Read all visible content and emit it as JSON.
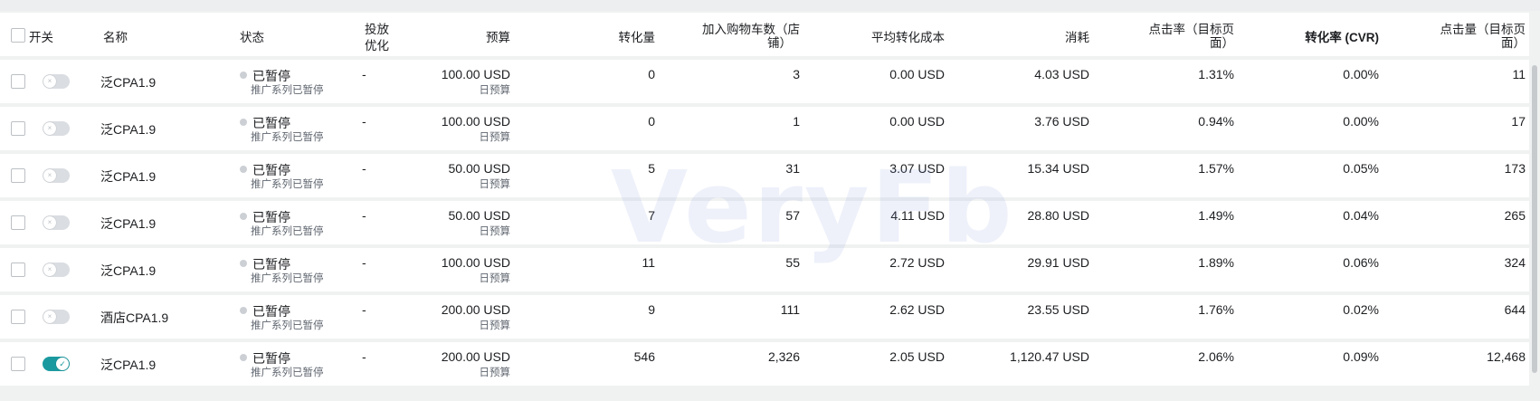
{
  "header": {
    "switch": "开关",
    "name": "名称",
    "status": "状态",
    "delivery_line1": "投放",
    "delivery_line2": "优化",
    "budget": "预算",
    "conversions": "转化量",
    "add_to_cart_line1": "加入购物车数（店",
    "add_to_cart_line2": "铺）",
    "avg_cost": "平均转化成本",
    "spend": "消耗",
    "ctr_line1": "点击率（目标页",
    "ctr_line2": "面）",
    "cvr": "转化率 (CVR)",
    "clicks_line1": "点击量（目标页",
    "clicks_line2": "面）"
  },
  "rows": [
    {
      "on": false,
      "name": "泛CPA1.9",
      "status": "已暂停",
      "status_sub": "推广系列已暂停",
      "delivery": "-",
      "budget": "100.00 USD",
      "budget_sub": "日预算",
      "conversions": "0",
      "add_to_cart": "3",
      "avg_cost": "0.00 USD",
      "spend": "4.03 USD",
      "ctr": "1.31%",
      "cvr": "0.00%",
      "clicks": "11"
    },
    {
      "on": false,
      "name": "泛CPA1.9",
      "status": "已暂停",
      "status_sub": "推广系列已暂停",
      "delivery": "-",
      "budget": "100.00 USD",
      "budget_sub": "日预算",
      "conversions": "0",
      "add_to_cart": "1",
      "avg_cost": "0.00 USD",
      "spend": "3.76 USD",
      "ctr": "0.94%",
      "cvr": "0.00%",
      "clicks": "17"
    },
    {
      "on": false,
      "name": "泛CPA1.9",
      "status": "已暂停",
      "status_sub": "推广系列已暂停",
      "delivery": "-",
      "budget": "50.00 USD",
      "budget_sub": "日预算",
      "conversions": "5",
      "add_to_cart": "31",
      "avg_cost": "3.07 USD",
      "spend": "15.34 USD",
      "ctr": "1.57%",
      "cvr": "0.05%",
      "clicks": "173"
    },
    {
      "on": false,
      "name": "泛CPA1.9",
      "status": "已暂停",
      "status_sub": "推广系列已暂停",
      "delivery": "-",
      "budget": "50.00 USD",
      "budget_sub": "日预算",
      "conversions": "7",
      "add_to_cart": "57",
      "avg_cost": "4.11 USD",
      "spend": "28.80 USD",
      "ctr": "1.49%",
      "cvr": "0.04%",
      "clicks": "265"
    },
    {
      "on": false,
      "name": "泛CPA1.9",
      "status": "已暂停",
      "status_sub": "推广系列已暂停",
      "delivery": "-",
      "budget": "100.00 USD",
      "budget_sub": "日预算",
      "conversions": "11",
      "add_to_cart": "55",
      "avg_cost": "2.72 USD",
      "spend": "29.91 USD",
      "ctr": "1.89%",
      "cvr": "0.06%",
      "clicks": "324"
    },
    {
      "on": false,
      "name": "酒店CPA1.9",
      "status": "已暂停",
      "status_sub": "推广系列已暂停",
      "delivery": "-",
      "budget": "200.00 USD",
      "budget_sub": "日预算",
      "conversions": "9",
      "add_to_cart": "111",
      "avg_cost": "2.62 USD",
      "spend": "23.55 USD",
      "ctr": "1.76%",
      "cvr": "0.02%",
      "clicks": "644"
    },
    {
      "on": true,
      "name": "泛CPA1.9",
      "status": "已暂停",
      "status_sub": "推广系列已暂停",
      "delivery": "-",
      "budget": "200.00 USD",
      "budget_sub": "日预算",
      "conversions": "546",
      "add_to_cart": "2,326",
      "avg_cost": "2.05 USD",
      "spend": "1,120.47 USD",
      "ctr": "2.06%",
      "cvr": "0.09%",
      "clicks": "12,468"
    }
  ],
  "watermark": "VeryFb",
  "colors": {
    "toggle_on": "#1a9a9f",
    "toggle_off": "#dadde1"
  }
}
